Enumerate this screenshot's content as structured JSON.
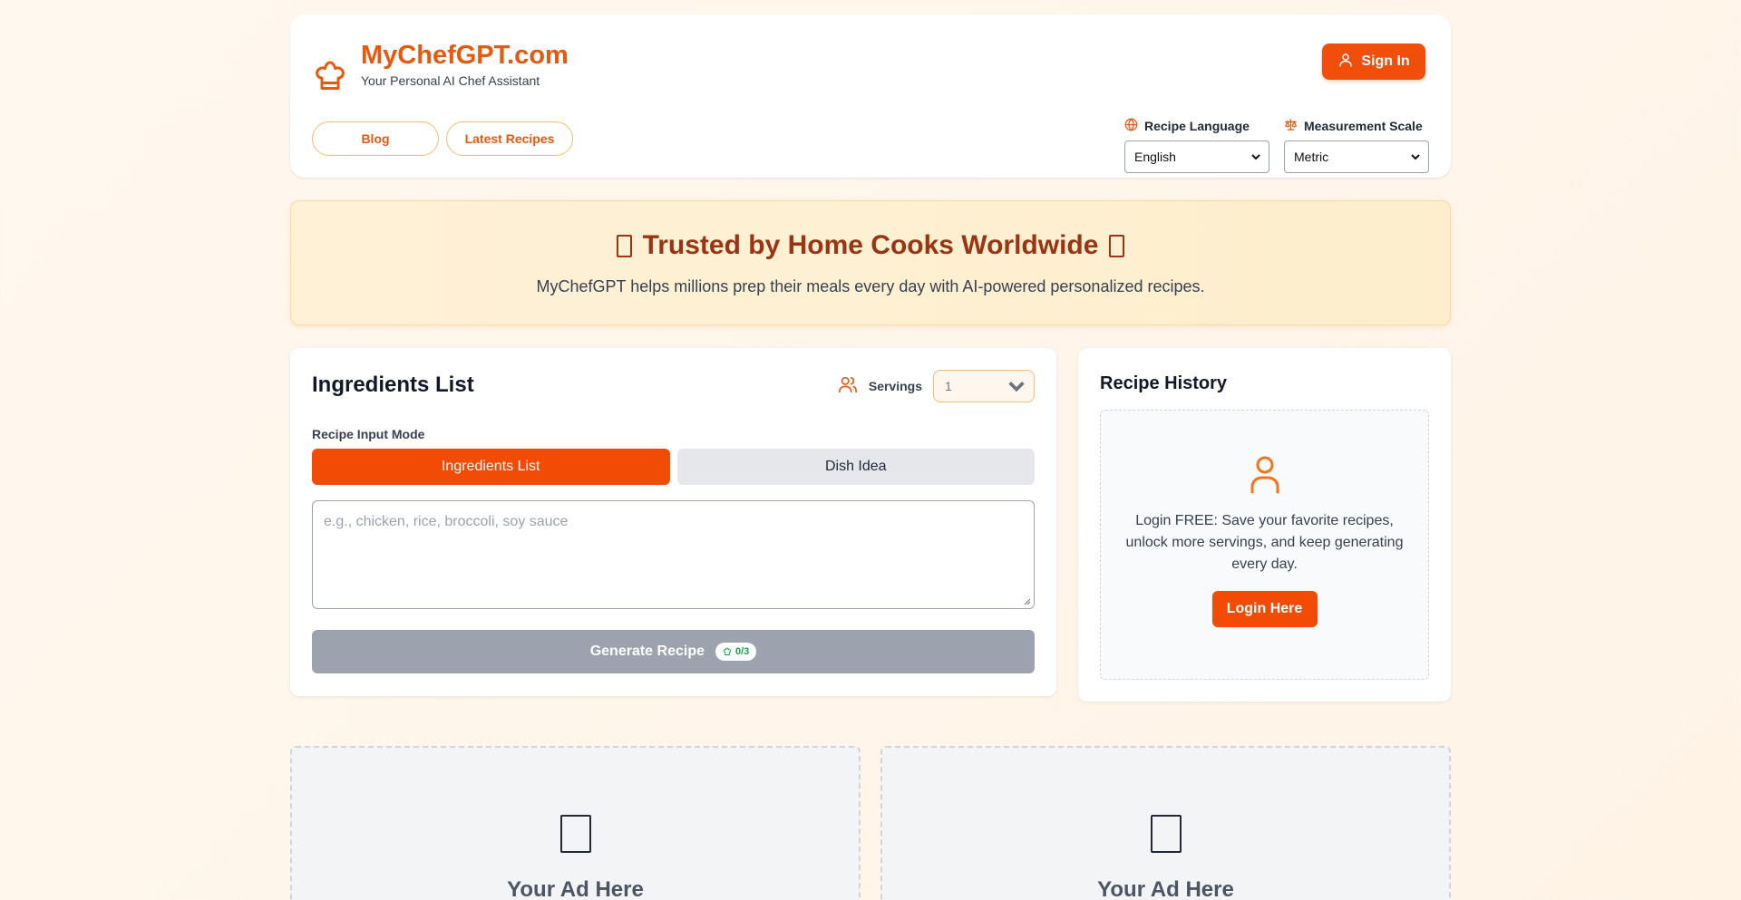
{
  "header": {
    "logo_title": "MyChefGPT.com",
    "logo_subtitle": "Your Personal AI Chef Assistant",
    "logo_icon": "chef-hat-icon",
    "nav": [
      {
        "label": "Blog"
      },
      {
        "label": "Latest Recipes"
      }
    ],
    "signin_label": "Sign In",
    "recipe_language": {
      "label": "Recipe Language",
      "value": "English",
      "icon": "globe-icon"
    },
    "measurement_scale": {
      "label": "Measurement Scale",
      "value": "Metric",
      "icon": "scale-icon"
    }
  },
  "banner": {
    "title": "Trusted by Home Cooks Worldwide",
    "subtitle": "MyChefGPT helps millions prep their meals every day with AI-powered personalized recipes."
  },
  "ingredients": {
    "title": "Ingredients List",
    "servings_label": "Servings",
    "servings_value": "1",
    "mode_label": "Recipe Input Mode",
    "mode_options": [
      "Ingredients List",
      "Dish Idea"
    ],
    "active_mode": "Ingredients List",
    "textarea_placeholder": "e.g., chicken, rice, broccoli, soy sauce",
    "generate_label": "Generate Recipe",
    "quota": "0/3"
  },
  "history": {
    "title": "Recipe History",
    "message": "Login FREE: Save your favorite recipes, unlock more servings, and keep generating every day.",
    "login_label": "Login Here"
  },
  "ads": [
    {
      "title": "Your Ad Here"
    },
    {
      "title": "Your Ad Here"
    }
  ],
  "colors": {
    "accent": "#f24b06",
    "brand": "#ea580c",
    "banner_title": "#9a3412",
    "disabled_button": "#9ca3af",
    "quota_text": "#16a34a"
  }
}
